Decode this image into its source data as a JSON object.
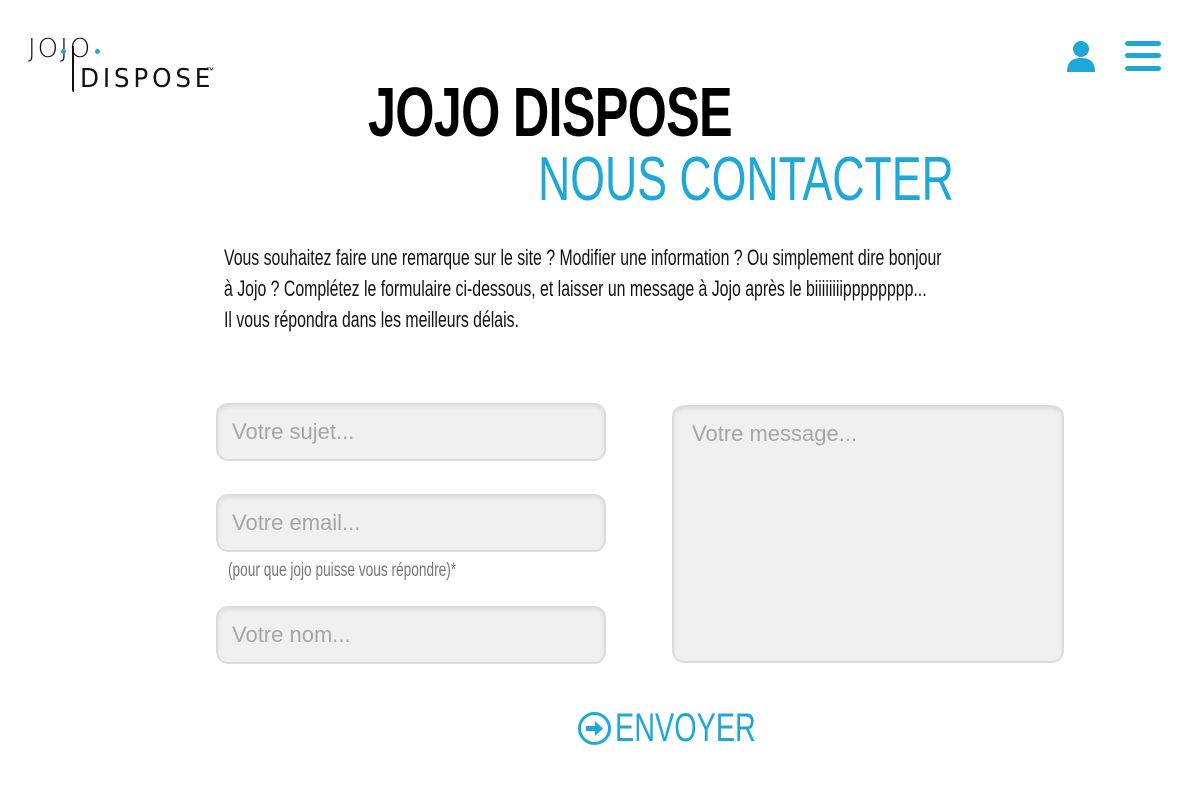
{
  "brand": {
    "logo_top": "JOJO",
    "logo_bottom": "DISPOSE",
    "logo_tm": "™",
    "accent_color": "#1ea8d8"
  },
  "header": {
    "user_icon": "user-icon",
    "menu_icon": "hamburger-menu-icon"
  },
  "page": {
    "title": "JOJO DISPOSE",
    "subtitle": "NOUS CONTACTER",
    "intro_line1": "Vous souhaitez faire une remarque sur le site ? Modifier une information ? Ou simplement dire bonjour",
    "intro_line2": "à Jojo ? Complétez le formulaire ci-dessous, et laisser un message à Jojo après le biiiiiiiipppppppp...",
    "intro_line3": "Il vous répondra dans les meilleurs délais."
  },
  "form": {
    "subject_placeholder": "Votre sujet...",
    "email_placeholder": "Votre email...",
    "email_hint": "(pour que jojo puisse vous répondre)*",
    "name_placeholder": "Votre nom...",
    "message_placeholder": "Votre message...",
    "submit_label": "ENVOYER",
    "submit_icon": "arrow-right-circle-icon"
  }
}
